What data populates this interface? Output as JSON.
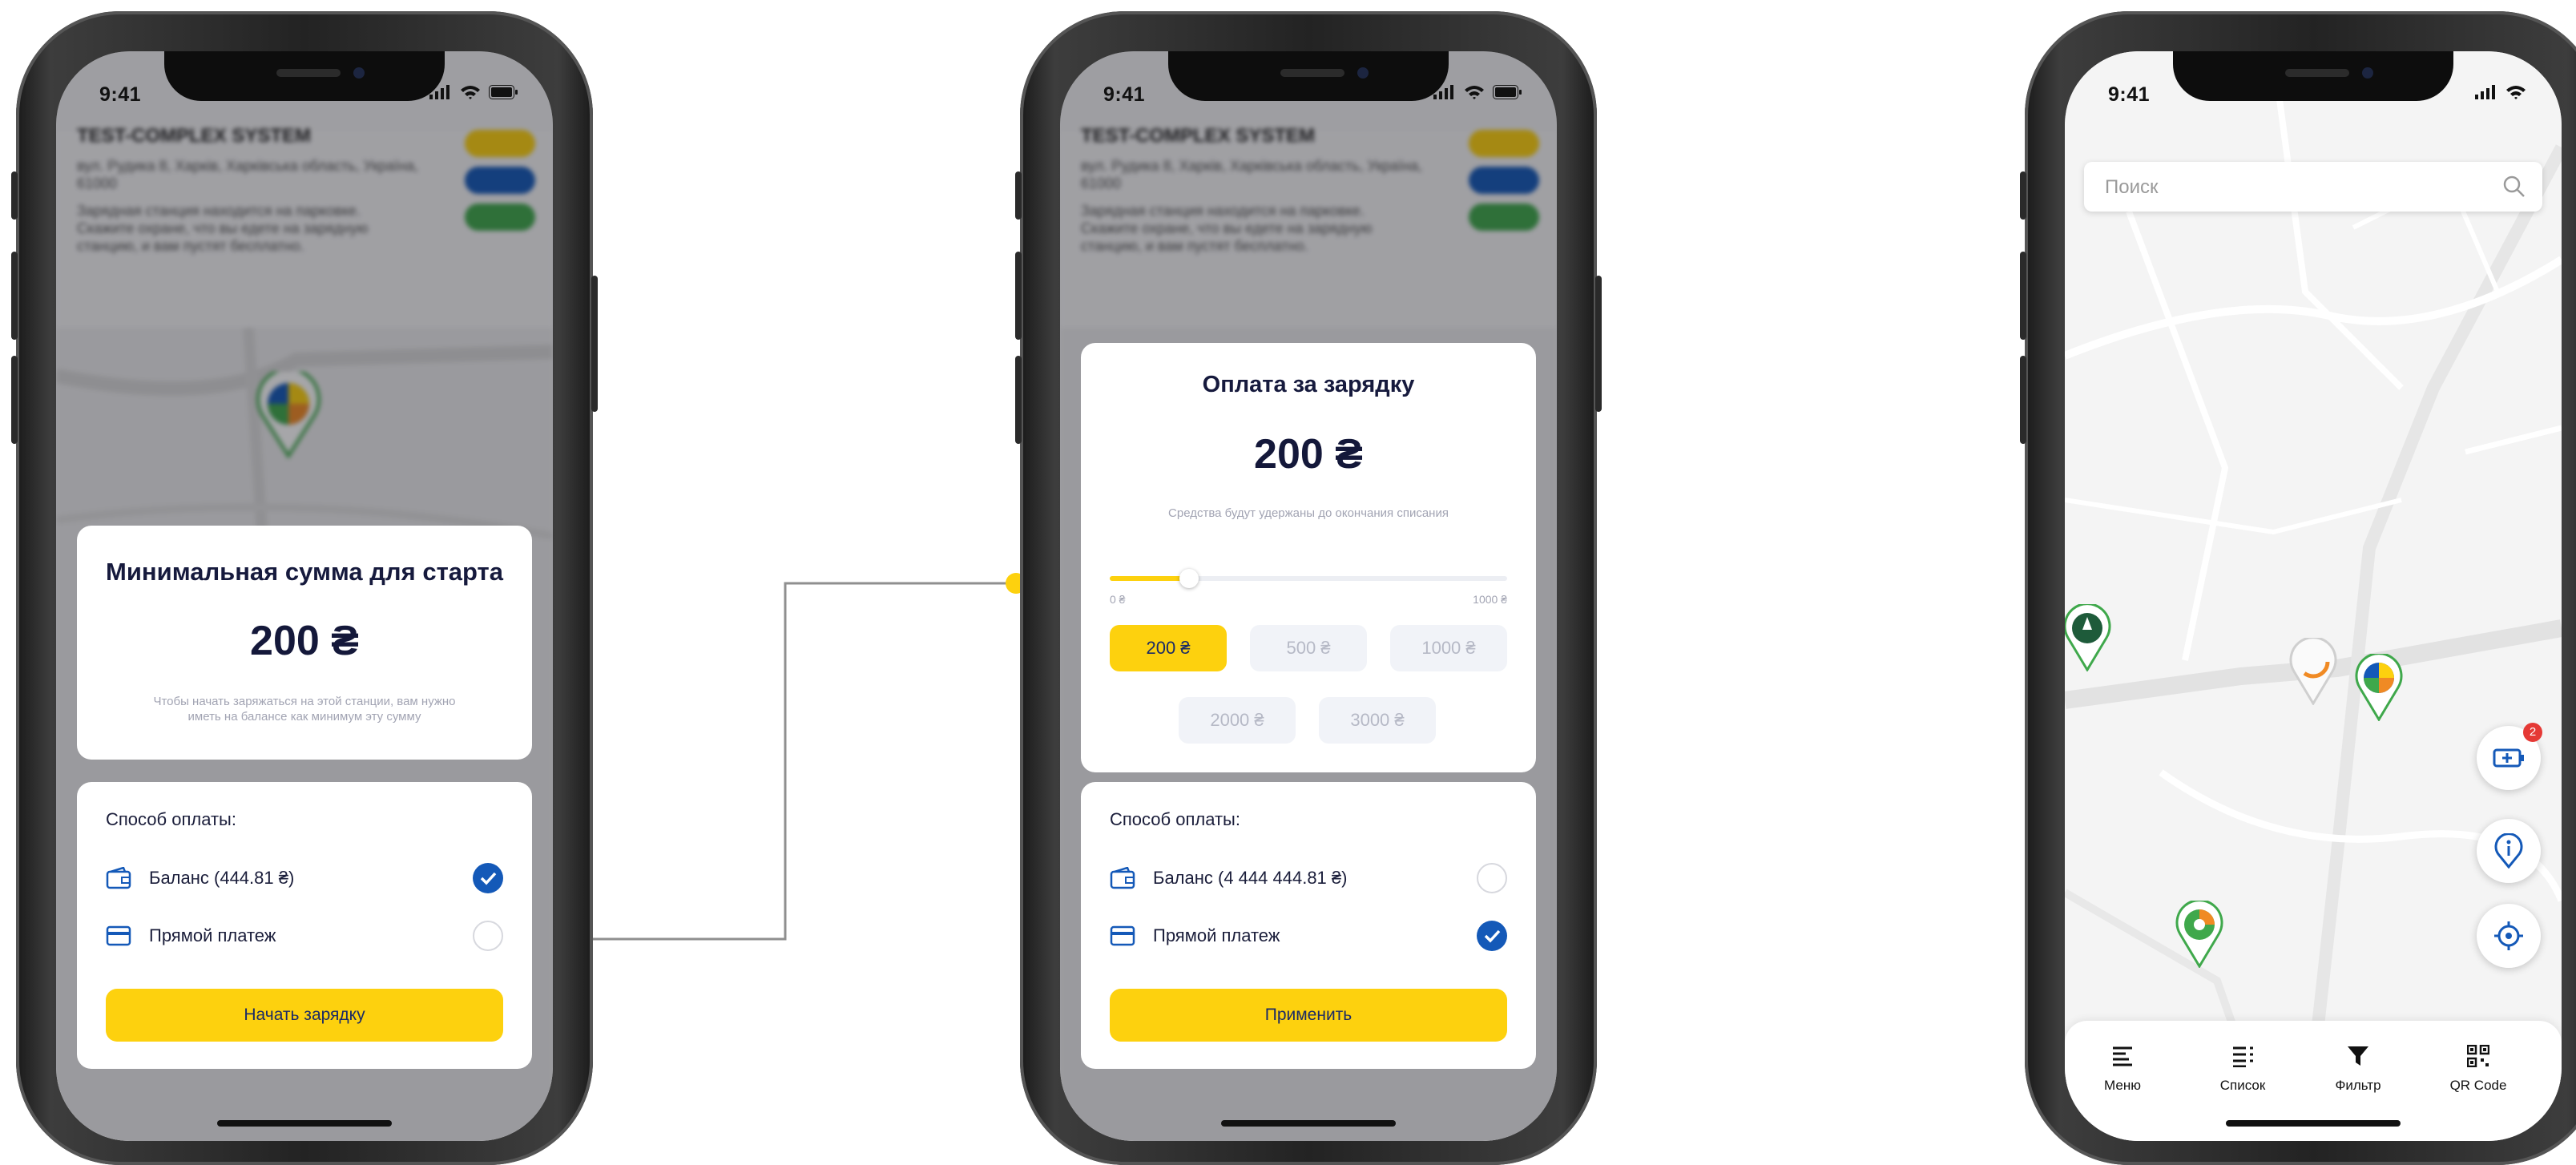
{
  "status": {
    "time": "9:41"
  },
  "screen1": {
    "station_name": "TEST-COMPLEX SYSTEM",
    "min_title": "Минимальная сумма для старта",
    "amount": "200 ₴",
    "hint": "Чтобы начать заряжаться на этой станции, вам нужно иметь на балансе как минимум эту сумму",
    "pay_label": "Способ оплаты:",
    "balance_label": "Баланс (444.81 ₴)",
    "direct_label": "Прямой платеж",
    "cta": "Начать зарядку",
    "selected": "balance"
  },
  "screen2": {
    "station_name": "TEST-COMPLEX SYSTEM",
    "title": "Оплата за зарядку",
    "amount": "200 ₴",
    "hint": "Средства будут удержаны до окончания списания",
    "slider_min": "0 ₴",
    "slider_max": "1000 ₴",
    "slider_value": 0.2,
    "chips": [
      "200 ₴",
      "500 ₴",
      "1000 ₴",
      "2000 ₴",
      "3000 ₴"
    ],
    "pay_label": "Способ оплаты:",
    "balance_label": "Баланс (4 444 444.81 ₴)",
    "direct_label": "Прямой платеж",
    "cta": "Применить",
    "selected": "direct"
  },
  "screen3": {
    "search_placeholder": "Поиск",
    "badge_count": "2",
    "tabs": [
      "Меню",
      "Список",
      "Фильтр",
      "QR Code"
    ]
  },
  "colors": {
    "accent": "#fdd10e",
    "primary": "#1459b8",
    "dark_text": "#14183a",
    "connector": "#9a9a9a"
  }
}
